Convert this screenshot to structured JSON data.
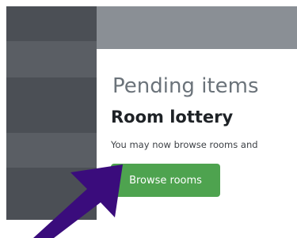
{
  "section": {
    "title": "Pending items",
    "item_title": "Room lottery",
    "item_description": "You may now browse rooms and",
    "browse_button_label": "Browse rooms"
  },
  "colors": {
    "sidebar": "#4b4f55",
    "topbar": "#8a8f95",
    "button": "#4ea34f",
    "arrow": "#3a0c7c"
  },
  "annotations": {
    "pointer": "arrow-icon"
  }
}
